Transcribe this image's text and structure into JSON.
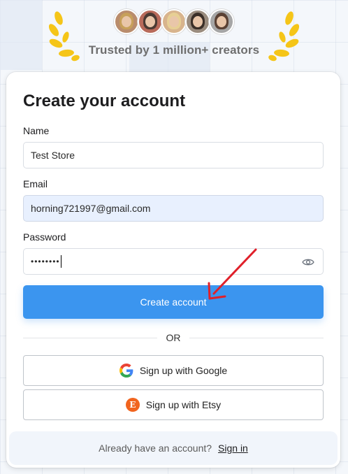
{
  "header": {
    "trusted_text": "Trusted by 1 million+ creators",
    "avatars": [
      {
        "bg": "#b98c6c",
        "hair": "#c7a05a"
      },
      {
        "bg": "#b86a5a",
        "hair": "#4a3a33"
      },
      {
        "bg": "#d8b48d",
        "hair": "#e7cf94"
      },
      {
        "bg": "#9a8c7e",
        "hair": "#3b2f28"
      },
      {
        "bg": "#a6a6a6",
        "hair": "#5a4134"
      }
    ],
    "laurel_color": "#f5c518"
  },
  "form": {
    "title": "Create your account",
    "name": {
      "label": "Name",
      "value": "Test Store"
    },
    "email": {
      "label": "Email",
      "value": "horning721997@gmail.com"
    },
    "password": {
      "label": "Password",
      "value": "••••••••"
    },
    "submit_label": "Create account",
    "or_label": "OR",
    "google_label": "Sign up with Google",
    "etsy_label": "Sign up with Etsy",
    "etsy_letter": "E"
  },
  "footer": {
    "prompt": "Already have an account?",
    "signin_label": "Sign in"
  },
  "colors": {
    "primary": "#3b95ef",
    "annotation_arrow": "#e0202a",
    "etsy": "#f1641e"
  }
}
